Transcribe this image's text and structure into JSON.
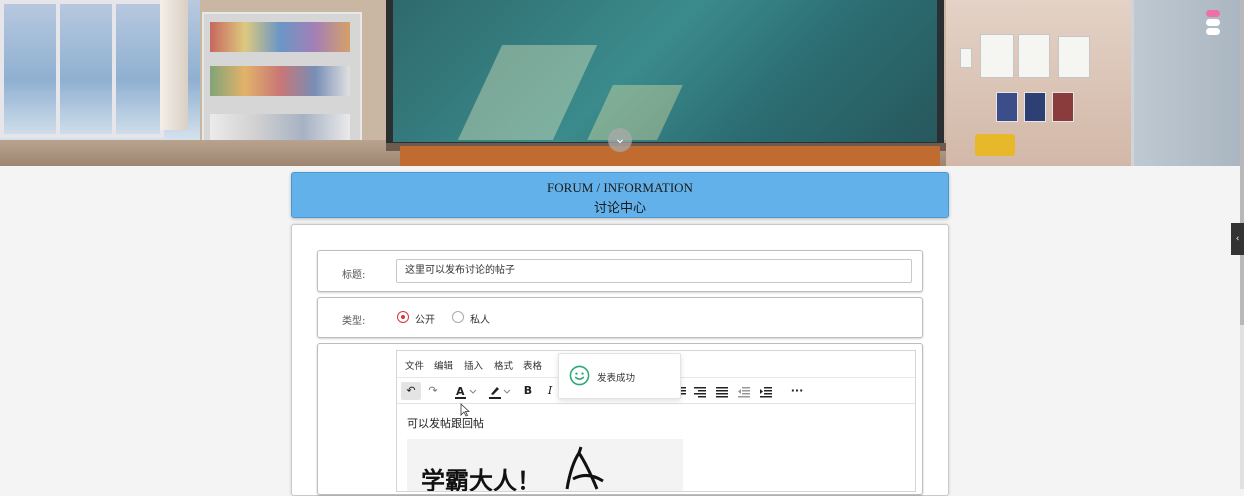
{
  "header": {
    "title_en": "FORUM / INFORMATION",
    "title_zh": "讨论中心"
  },
  "form": {
    "title_label": "标题:",
    "title_value": "这里可以发布讨论的帖子",
    "type_label": "类型:",
    "type_options": [
      {
        "label": "公开",
        "selected": true
      },
      {
        "label": "私人",
        "selected": false
      }
    ]
  },
  "editor": {
    "menus": [
      "文件",
      "编辑",
      "插入",
      "格式",
      "表格"
    ],
    "toolbar": {
      "undo": "↶",
      "redo": "↷",
      "bold": "B",
      "italic": "I",
      "more": "···"
    },
    "content_text": "可以发帖跟回帖",
    "image_text": "学霸大人！"
  },
  "toast": {
    "message": "发表成功",
    "icon": "smile-icon"
  },
  "colors": {
    "header_bg": "#62b1ea",
    "radio_accent": "#d9363e",
    "toast_icon": "#2aa876"
  }
}
